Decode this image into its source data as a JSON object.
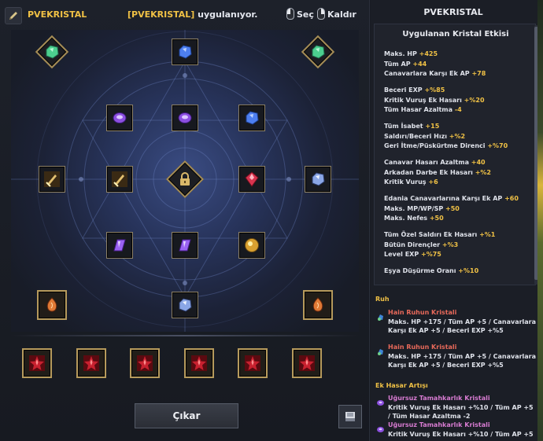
{
  "header": {
    "preset_name": "PVEKRISTAL",
    "status_highlight": "[PVEKRISTAL]",
    "status_suffix": " uygulanıyor.",
    "select_label": "Seç",
    "remove_label": "Kaldır"
  },
  "footer": {
    "remove_button_label": "Çıkar"
  },
  "panel": {
    "title": "PVEKRISTAL",
    "effect_title": "Uygulanan Kristal Etkisi",
    "stats": [
      {
        "text": "Maks. HP ",
        "value": "+425"
      },
      {
        "text": "Tüm AP ",
        "value": "+44"
      },
      {
        "text": "Canavarlara Karşı Ek AP ",
        "value": "+78"
      },
      {
        "text": "Beceri EXP ",
        "value": "+%85"
      },
      {
        "text": "Kritik Vuruş Ek Hasarı ",
        "value": "+%20"
      },
      {
        "text": "Tüm Hasar Azaltma ",
        "value": "-4"
      },
      {
        "text": "Tüm İsabet ",
        "value": "+15"
      },
      {
        "text": "Saldırı/Beceri Hızı ",
        "value": "+%2"
      },
      {
        "text": "Geri İtme/Püskürtme Direnci ",
        "value": "+%70"
      },
      {
        "text": "Canavar Hasarı Azaltma ",
        "value": "+40"
      },
      {
        "text": "Arkadan Darbe Ek Hasarı ",
        "value": "+%2"
      },
      {
        "text": "Kritik Vuruş ",
        "value": "+6"
      },
      {
        "text": "Edania Canavarlarına Karşı Ek AP ",
        "value": "+60"
      },
      {
        "text": "Maks. MP/WP/SP ",
        "value": "+50"
      },
      {
        "text": "Maks. Nefes ",
        "value": "+50"
      },
      {
        "text": "Tüm Özel Saldırı Ek Hasarı ",
        "value": "+%1"
      },
      {
        "text": "Bütün Dirençler ",
        "value": "+%3"
      },
      {
        "text": "Level EXP ",
        "value": "+%75"
      },
      {
        "text": "Eşya Düşürme Oranı ",
        "value": "+%10"
      }
    ],
    "categories": [
      {
        "name": "Ruh",
        "crystals": [
          {
            "name": "Hain Ruhun Kristali",
            "desc": "Maks. HP +175 / Tüm AP +5 / Canavarlara Karşı Ek AP +5 / Beceri EXP +%5"
          },
          {
            "name": "Hain Ruhun Kristali",
            "desc": "Maks. HP +175 / Tüm AP +5 / Canavarlara Karşı Ek AP +5 / Beceri EXP +%5"
          }
        ]
      },
      {
        "name": "Ek Hasar Artışı",
        "crystals": [
          {
            "name": "Uğursuz Tamahkarlık Kristali",
            "desc": "Kritik Vuruş Ek Hasarı +%10 / Tüm AP +5 / Tüm Hasar Azaltma -2"
          },
          {
            "name": "Uğursuz Tamahkarlık Kristali",
            "desc": "Kritik Vuruş Ek Hasarı +%10 / Tüm AP +5"
          }
        ]
      }
    ]
  },
  "colors": {
    "accent_gold": "#f0c145",
    "crystal_red_name": "#e8695a",
    "crystal_purple_name": "#d77bd1"
  },
  "icons": {
    "edit": "pencil-icon",
    "mouse": "mouse-icon",
    "lock": "lock-icon",
    "save": "save-icon"
  }
}
